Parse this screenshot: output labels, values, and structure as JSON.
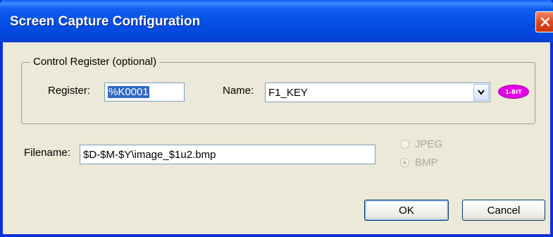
{
  "window": {
    "title": "Screen Capture Configuration"
  },
  "control_register": {
    "legend": "Control Register (optional)",
    "register_label": "Register:",
    "register_value": "%K0001",
    "name_label": "Name:",
    "name_value": "F1_KEY",
    "badge": "1-BIT"
  },
  "file": {
    "filename_label": "Filename:",
    "filename_value": "$D-$M-$Y\\image_$1u2.bmp"
  },
  "format": {
    "options": [
      {
        "label": "JPEG",
        "selected": false,
        "enabled": false
      },
      {
        "label": "BMP",
        "selected": true,
        "enabled": false
      }
    ]
  },
  "buttons": {
    "ok": "OK",
    "cancel": "Cancel"
  },
  "icons": {
    "close": "close-icon",
    "dropdown": "chevron-down-icon"
  },
  "colors": {
    "titlebar": "#0550e6",
    "close_button": "#e0461c",
    "badge": "#e600e6",
    "selection": "#316ac5"
  }
}
